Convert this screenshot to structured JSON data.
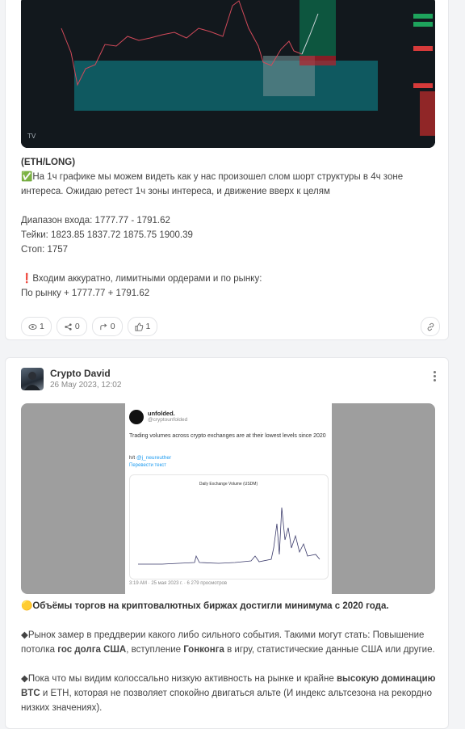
{
  "post1": {
    "chart_alt": "ETH 1h chart",
    "heading": "(ETH/LONG)",
    "line1": "✅На 1ч графике мы можем видеть как у нас произошел слом шорт структуры в 4ч зоне",
    "line2": "интереса. Ожидаю ретест 1ч зоны интереса, и движение вверх к целям",
    "entry": "Диапазон входа: 1777.77 - 1791.62",
    "targets": "Тейки: 1823.85 1837.72 1875.75 1900.39",
    "stop": "Стоп: 1757",
    "note1": "❗Входим аккуратно, лимитными ордерами и по рынку:",
    "note2": "По рынку + 1777.77 + 1791.62",
    "stats": {
      "views": "1",
      "shares": "0",
      "reposts": "0",
      "likes": "1"
    }
  },
  "post2": {
    "author": "Crypto David",
    "date": "26 May 2023, 12:02",
    "tweet": {
      "name": "unfolded.",
      "handle": "@cryptounfolded",
      "text": "Trading volumes across crypto exchanges are at their lowest levels since 2020",
      "ht_prefix": "h/t ",
      "ht_user": "@j_neureuther",
      "translate": "Перевести текст",
      "chart_title": "Daily Exchange Volume (USDM)",
      "footer": "3:19 AM · 25 мая 2023 г. · 6 279 просмотров"
    },
    "headline": "Объёмы торгов на криптовалютных биржах достигли минимума с 2020 года.",
    "p1_a": "Рынок замер в преддверии какого либо сильного события. Такими могут стать: Повышение",
    "p1_b": "потолка ",
    "p1_b_bold1": "гос долга США",
    "p1_b_mid": ", вступление ",
    "p1_b_bold2": "Гонконга",
    "p1_b_end": " в игру, статистические данные США или другие.",
    "p2_a": "Пока что мы видим колоссально низкую активность на рынке и крайне ",
    "p2_a_bold": "высокую доминацию",
    "p2_b_bold": "BTC",
    "p2_b": " и ETH, которая не позволяет спокойно двигаться альте (И индекс альтсезона на рекордно",
    "p2_c": "низких значениях)."
  }
}
